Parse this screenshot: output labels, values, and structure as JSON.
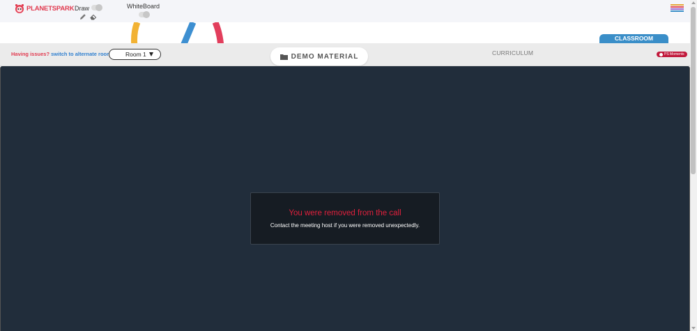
{
  "header": {
    "logo_text": "PLANETSPARK",
    "draw_label": "Draw",
    "whiteboard_label": "WhiteBoard",
    "menu_colors": [
      "#e6a73a",
      "#e24a5a",
      "#9c6cd0",
      "#3a8ec8",
      "#47b86a"
    ]
  },
  "tabs": {
    "classroom": "CLASSROOM",
    "demo_material": "DEMO MATERIAL",
    "curriculum": "CURRICULUM",
    "ps_moments": "PS Moments"
  },
  "toolbar": {
    "issue_question": "Having issues?",
    "issue_link": "switch to alternate room",
    "room_value": "Room 1"
  },
  "dialog": {
    "title": "You were removed from the call",
    "message": "Contact the meeting host if you were removed unexpectedly."
  },
  "colors": {
    "accent_blue": "#3a8ec8",
    "alert_red": "#e0203c",
    "stage_bg": "#212d3b"
  }
}
